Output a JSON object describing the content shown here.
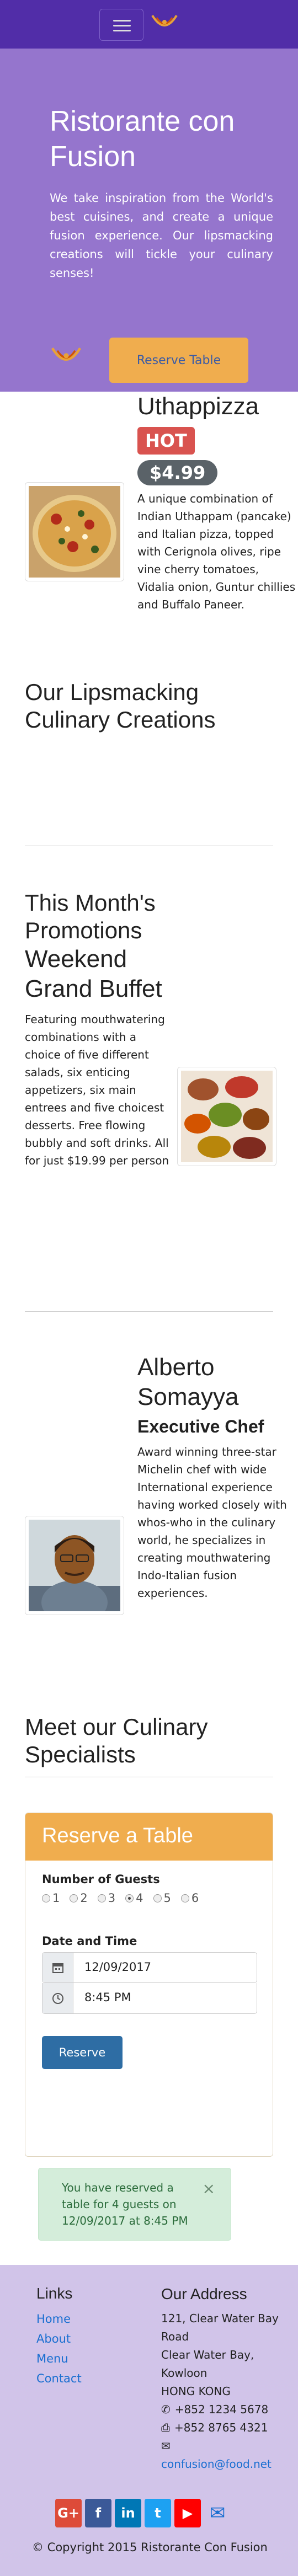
{
  "nav": {
    "toggler_icon": "hamburger-icon",
    "logo_icon": "restaurant-logo-icon",
    "brand_color": "#512da8"
  },
  "jumbotron": {
    "title": "Ristorante con Fusion",
    "text": "We take inspiration from the World's best cuisines, and create a unique fusion experience. Our lipsmacking creations will tickle your culinary senses!",
    "reserve_button": "Reserve Table",
    "background": "#9575cd",
    "button_color": "#f0ad4e"
  },
  "featured": {
    "name": "Uthappizza",
    "badge": "HOT",
    "price": "$4.99",
    "description": "A unique combination of Indian Uthappam (pancake) and Italian pizza, topped with Cerignola olives, ripe vine cherry tomatoes, Vidalia onion, Guntur chillies and Buffalo Paneer.",
    "section_heading": "Our Lipsmacking Culinary Creations"
  },
  "promotion": {
    "section_heading": "This Month's Promotions",
    "name": "Weekend Grand Buffet",
    "description": "Featuring mouthwatering combinations with a choice of five different salads, six enticing appetizers, six main entrees and five choicest desserts. Free flowing bubbly and soft drinks. All for just $19.99 per person"
  },
  "leader": {
    "name": "Alberto Somayya",
    "designation": "Executive Chef",
    "description": "Award winning three-star Michelin chef with wide International experience having worked closely with whos-who in the culinary world, he specializes in creating mouthwatering Indo-Italian fusion experiences.",
    "section_heading": "Meet our Culinary Specialists"
  },
  "reservation": {
    "title": "Reserve a Table",
    "guests_label": "Number of Guests",
    "guest_options": [
      "1",
      "2",
      "3",
      "4",
      "5",
      "6"
    ],
    "guests_selected": "4",
    "datetime_label": "Date and Time",
    "date_value": "12/09/2017",
    "time_value": "8:45 PM",
    "date_icon": "calendar-icon",
    "time_icon": "clock-icon",
    "submit_label": "Reserve",
    "alert_text": "You have reserved a table for 4 guests on 12/09/2017 at 8:45 PM",
    "alert_close": "×"
  },
  "footer": {
    "links_heading": "Links",
    "links": [
      "Home",
      "About",
      "Menu",
      "Contact"
    ],
    "address_heading": "Our Address",
    "address_lines": [
      "121, Clear Water Bay Road",
      "Clear Water Bay, Kowloon",
      "HONG KONG"
    ],
    "phone": "+852 1234 5678",
    "fax": "+852 8765 4321",
    "email": "confusion@food.net",
    "social": [
      {
        "icon": "google-plus-icon",
        "glyph": "G+",
        "color": "#dd4b39"
      },
      {
        "icon": "facebook-icon",
        "glyph": "f",
        "color": "#3b5998"
      },
      {
        "icon": "linkedin-icon",
        "glyph": "in",
        "color": "#0077b5"
      },
      {
        "icon": "twitter-icon",
        "glyph": "t",
        "color": "#1da1f2"
      },
      {
        "icon": "youtube-icon",
        "glyph": "▶",
        "color": "#ff0000"
      },
      {
        "icon": "mail-icon",
        "glyph": "✉",
        "color": "#1a6fd1"
      }
    ],
    "copyright": "© Copyright 2015 Ristorante Con Fusion",
    "background": "#d1c4e9"
  }
}
